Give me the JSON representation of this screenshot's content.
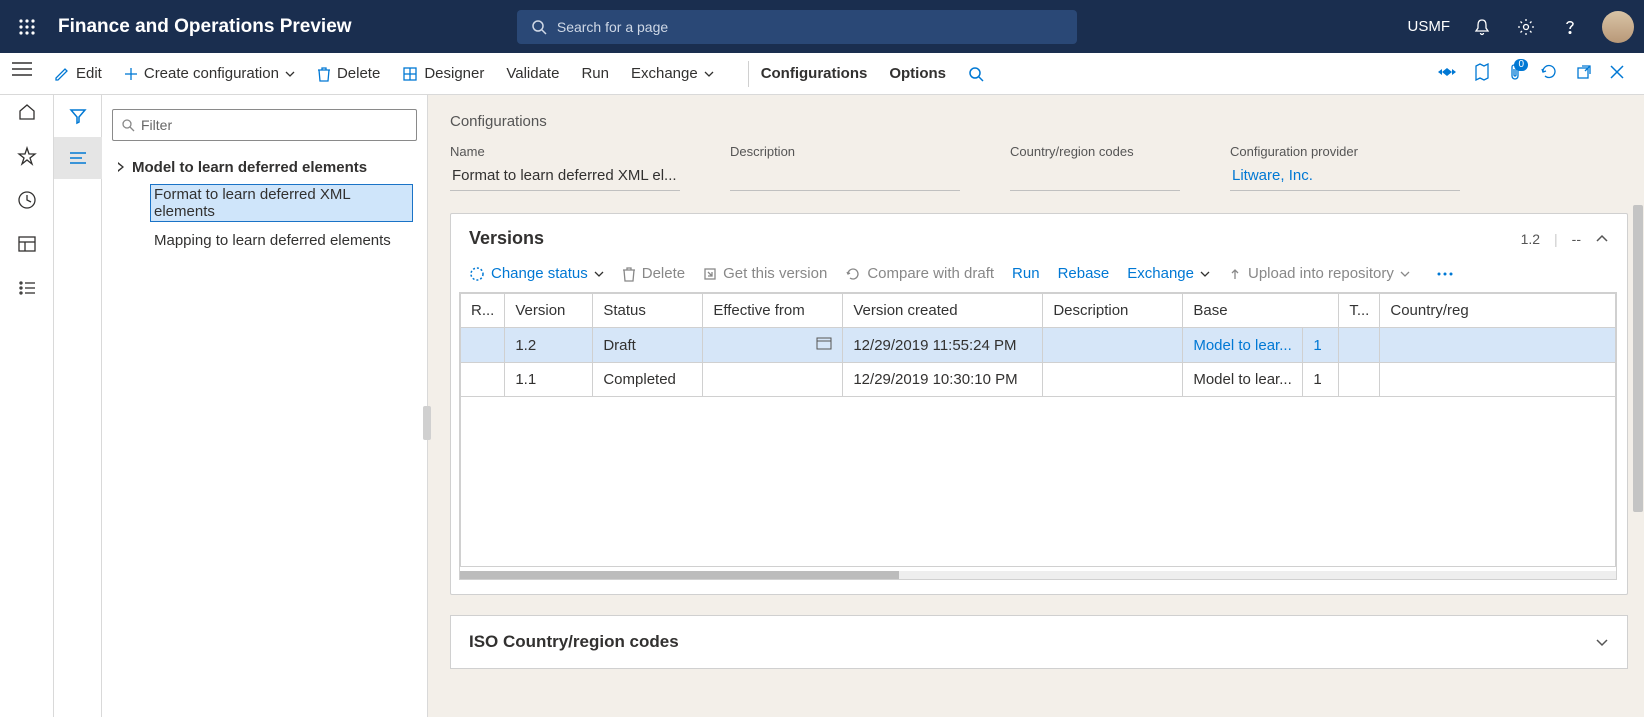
{
  "topbar": {
    "app_title": "Finance and Operations Preview",
    "search_placeholder": "Search for a page",
    "company": "USMF"
  },
  "commands": {
    "edit": "Edit",
    "create": "Create configuration",
    "delete": "Delete",
    "designer": "Designer",
    "validate": "Validate",
    "run": "Run",
    "exchange": "Exchange",
    "configurations": "Configurations",
    "options": "Options",
    "attach_badge": "0"
  },
  "tree": {
    "filter_placeholder": "Filter",
    "root": "Model to learn deferred elements",
    "children": [
      "Format to learn deferred XML elements",
      "Mapping to learn deferred elements"
    ]
  },
  "page": {
    "breadcrumb": "Configurations",
    "fields": {
      "name_label": "Name",
      "name_value": "Format to learn deferred XML el...",
      "desc_label": "Description",
      "desc_value": "",
      "codes_label": "Country/region codes",
      "codes_value": "",
      "provider_label": "Configuration provider",
      "provider_value": "Litware, Inc."
    }
  },
  "versions": {
    "title": "Versions",
    "current": "1.2",
    "dash": "--",
    "toolbar": {
      "change_status": "Change status",
      "delete": "Delete",
      "get": "Get this version",
      "compare": "Compare with draft",
      "run": "Run",
      "rebase": "Rebase",
      "exchange": "Exchange",
      "upload": "Upload into repository"
    },
    "columns": [
      "R...",
      "Version",
      "Status",
      "Effective from",
      "Version created",
      "Description",
      "Base",
      "",
      "T...",
      "Country/reg"
    ],
    "rows": [
      {
        "version": "1.2",
        "status": "Draft",
        "effective": "",
        "created": "12/29/2019 11:55:24 PM",
        "description": "",
        "base": "Model to lear...",
        "base_num": "1",
        "selected": true
      },
      {
        "version": "1.1",
        "status": "Completed",
        "effective": "",
        "created": "12/29/2019 10:30:10 PM",
        "description": "",
        "base": "Model to lear...",
        "base_num": "1",
        "selected": false
      }
    ]
  },
  "iso": {
    "title": "ISO Country/region codes"
  }
}
